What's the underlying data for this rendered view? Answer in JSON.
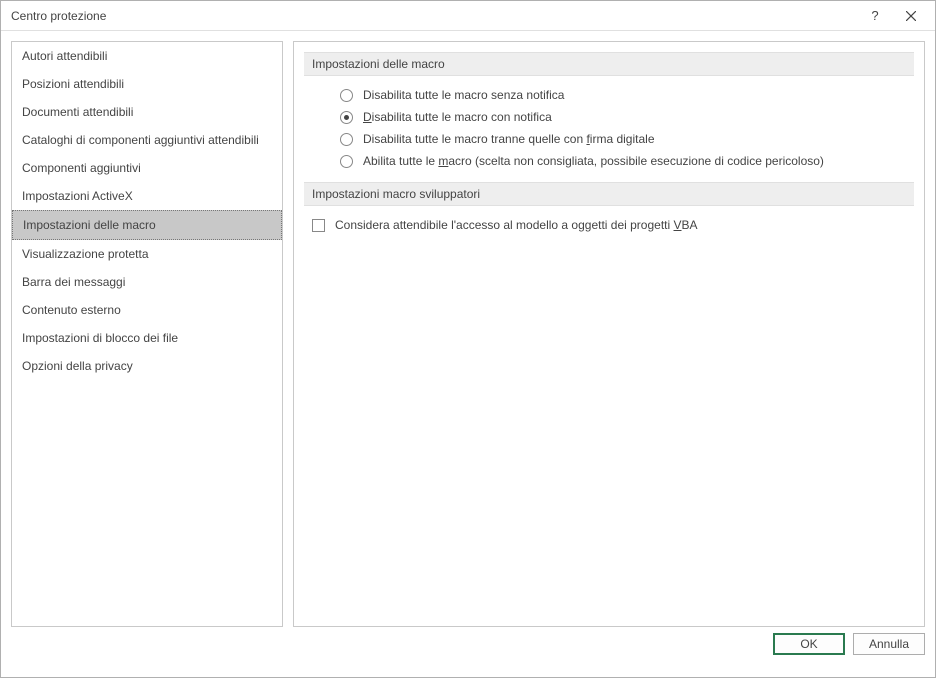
{
  "window": {
    "title": "Centro protezione"
  },
  "sidebar": {
    "items": [
      {
        "label": "Autori attendibili"
      },
      {
        "label": "Posizioni attendibili"
      },
      {
        "label": "Documenti attendibili"
      },
      {
        "label": "Cataloghi di componenti aggiuntivi attendibili"
      },
      {
        "label": "Componenti aggiuntivi"
      },
      {
        "label": "Impostazioni ActiveX"
      },
      {
        "label": "Impostazioni delle macro"
      },
      {
        "label": "Visualizzazione protetta"
      },
      {
        "label": "Barra dei messaggi"
      },
      {
        "label": "Contenuto esterno"
      },
      {
        "label": "Impostazioni di blocco dei file"
      },
      {
        "label": "Opzioni della privacy"
      }
    ],
    "selected_index": 6
  },
  "main": {
    "section1_heading": "Impostazioni delle macro",
    "radios": {
      "r1": "Disabilita tutte le macro senza notifica",
      "r2_pre": "D",
      "r2_post": "isabilita tutte le macro con notifica",
      "r3_pre": "Disabilita tutte le macro tranne quelle con ",
      "r3_mid": "f",
      "r3_post": "irma digitale",
      "r4_pre": "Abilita tutte le ",
      "r4_mid": "m",
      "r4_post": "acro (scelta non consigliata, possibile esecuzione di codice pericoloso)"
    },
    "section2_heading": "Impostazioni macro sviluppatori",
    "checkbox_pre": "Considera attendibile l'accesso al modello a oggetti dei progetti ",
    "checkbox_mid": "V",
    "checkbox_post": "BA"
  },
  "buttons": {
    "ok": "OK",
    "cancel": "Annulla"
  }
}
